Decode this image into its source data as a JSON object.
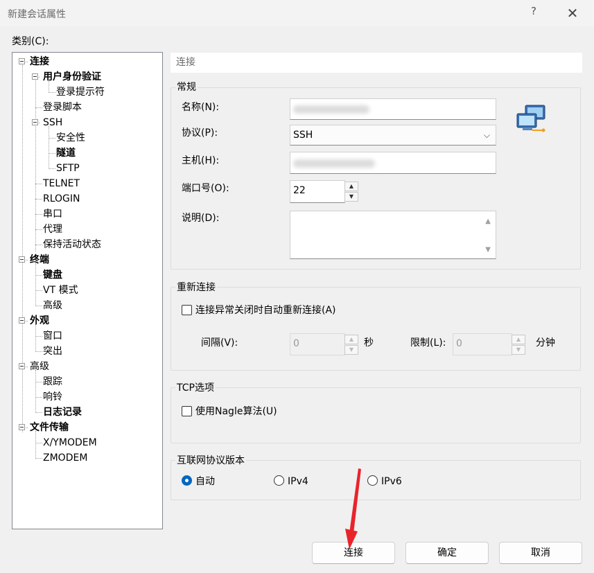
{
  "window": {
    "title": "新建会话属性",
    "help_label": "?",
    "close_label": "✕"
  },
  "category_label": "类别(C):",
  "tree": [
    {
      "label": "连接",
      "bold": true
    },
    {
      "label": "用户身份验证",
      "bold": true
    },
    {
      "label": "登录提示符",
      "bold": false
    },
    {
      "label": "登录脚本",
      "bold": false
    },
    {
      "label": "SSH",
      "bold": false
    },
    {
      "label": "安全性",
      "bold": false
    },
    {
      "label": "隧道",
      "bold": true
    },
    {
      "label": "SFTP",
      "bold": false
    },
    {
      "label": "TELNET",
      "bold": false
    },
    {
      "label": "RLOGIN",
      "bold": false
    },
    {
      "label": "串口",
      "bold": false
    },
    {
      "label": "代理",
      "bold": false
    },
    {
      "label": "保持活动状态",
      "bold": false
    },
    {
      "label": "终端",
      "bold": true
    },
    {
      "label": "键盘",
      "bold": true
    },
    {
      "label": "VT 模式",
      "bold": false
    },
    {
      "label": "高级",
      "bold": false
    },
    {
      "label": "外观",
      "bold": true
    },
    {
      "label": "窗口",
      "bold": false
    },
    {
      "label": "突出",
      "bold": false
    },
    {
      "label": "高级",
      "bold": false
    },
    {
      "label": "跟踪",
      "bold": false
    },
    {
      "label": "响铃",
      "bold": false
    },
    {
      "label": "日志记录",
      "bold": true
    },
    {
      "label": "文件传输",
      "bold": true
    },
    {
      "label": "X/YMODEM",
      "bold": false
    },
    {
      "label": "ZMODEM",
      "bold": false
    }
  ],
  "section_header": "连接",
  "general": {
    "title": "常规",
    "name_label": "名称(N):",
    "protocol_label": "协议(P):",
    "protocol_value": "SSH",
    "host_label": "主机(H):",
    "port_label": "端口号(O):",
    "port_value": "22",
    "desc_label": "说明(D):"
  },
  "reconnect": {
    "title": "重新连接",
    "checkbox_label": "连接异常关闭时自动重新连接(A)",
    "interval_label": "间隔(V):",
    "interval_value": "0",
    "interval_unit": "秒",
    "limit_label": "限制(L):",
    "limit_value": "0",
    "limit_unit": "分钟"
  },
  "tcp": {
    "title": "TCP选项",
    "nagle_label": "使用Nagle算法(U)"
  },
  "ipver": {
    "title": "互联网协议版本",
    "options": [
      "自动",
      "IPv4",
      "IPv6"
    ],
    "selected": "自动"
  },
  "buttons": {
    "connect": "连接",
    "ok": "确定",
    "cancel": "取消"
  },
  "colors": {
    "accent": "#0067c0",
    "annotation_arrow": "#e8242b"
  }
}
